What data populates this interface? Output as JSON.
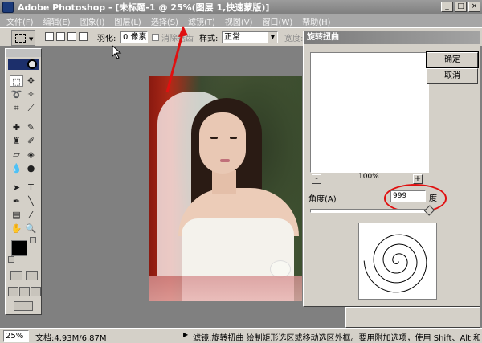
{
  "window": {
    "title": "Adobe Photoshop - [未标题-1 @ 25%(图层 1,快速蒙版)]",
    "controls": [
      "_",
      "□",
      "×"
    ]
  },
  "menubar": {
    "items": [
      "文件(F)",
      "编辑(E)",
      "图象(I)",
      "图层(L)",
      "选择(S)",
      "滤镜(T)",
      "视图(V)",
      "窗口(W)",
      "帮助(H)"
    ]
  },
  "options": {
    "feather_label": "羽化:",
    "feather_value": "0 像素",
    "antialias_label": "消除锯齿",
    "style_label": "样式:",
    "style_value": "正常",
    "width_label": "宽度:"
  },
  "dialog": {
    "title": "旋转扭曲",
    "ok": "确定",
    "cancel": "取消",
    "zoom": "100%",
    "zoom_minus": "-",
    "zoom_plus": "+",
    "angle_label": "角度(A)",
    "angle_value": "999",
    "degree_unit": "度",
    "angle_fraction": 0.999
  },
  "status": {
    "zoom": "25%",
    "doc": "文档:4.93M/6.87M",
    "hint": "滤镜:旋转扭曲  绘制矩形选区或移动选区外框。要用附加选项，使用 Shift、Alt 和 Ctrl 键"
  },
  "colors": {
    "annotation": "#e01010",
    "titlebar": "#8c8c8c",
    "dialog_bg": "#d4d0c8"
  }
}
